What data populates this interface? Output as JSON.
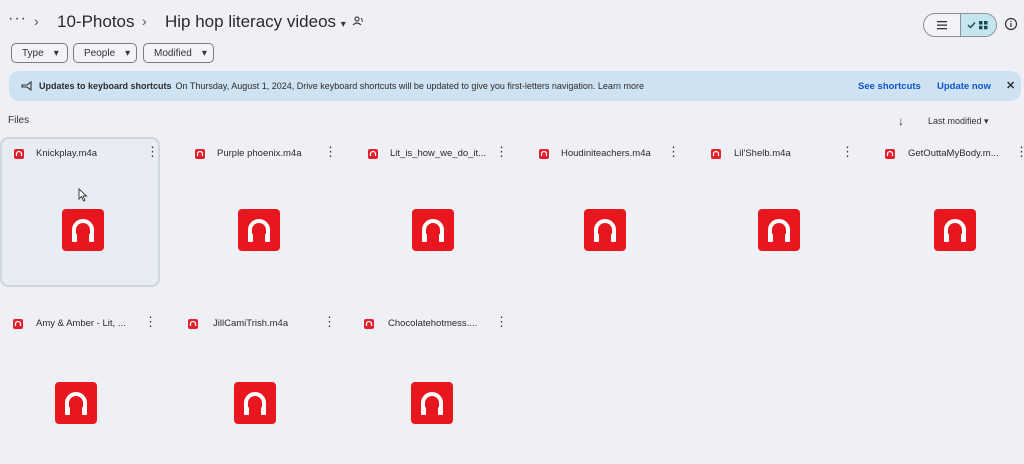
{
  "breadcrumb": {
    "more": "···",
    "sep": "›",
    "parent": "10-Photos",
    "current": "Hip hop literacy videos",
    "caret": "▾"
  },
  "filters": [
    {
      "label": "Type",
      "caret": "▾"
    },
    {
      "label": "People",
      "caret": "▾"
    },
    {
      "label": "Modified",
      "caret": "▾"
    }
  ],
  "banner": {
    "title": "Updates to keyboard shortcuts",
    "text": "On Thursday, August 1, 2024, Drive keyboard shortcuts will be updated to give you first-letters navigation. Learn more",
    "see_shortcuts": "See shortcuts",
    "update_now": "Update now",
    "close": "✕"
  },
  "section": {
    "files_label": "Files",
    "sort_arrow": "↓",
    "sort_label": "Last modified ▾"
  },
  "files": [
    {
      "name": "Knickplay.m4a"
    },
    {
      "name": "Purple phoenix.m4a"
    },
    {
      "name": "Lit_is_how_we_do_it..."
    },
    {
      "name": "Houdiniteachers.m4a"
    },
    {
      "name": "Lil'Shelb.m4a"
    },
    {
      "name": "GetOuttaMyBody.m..."
    },
    {
      "name": "Amy & Amber - Lit, ..."
    },
    {
      "name": "JillCamiTrish.m4a"
    },
    {
      "name": "Chocolatehotmess...."
    }
  ],
  "kebab": "⋮",
  "colors": {
    "audio_red": "#e8171f",
    "link_blue": "#0b57d0",
    "banner_bg": "#cfe2f2"
  }
}
